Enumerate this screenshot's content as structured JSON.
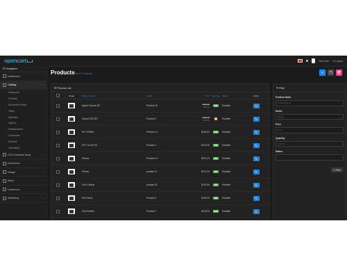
{
  "header": {
    "logo_text": "opencart",
    "user_name": "John Doe",
    "logout_label": "Logout"
  },
  "sidebar": {
    "title": "Navigation",
    "items": [
      {
        "label": "Dashboard"
      },
      {
        "label": "Catalog"
      },
      {
        "label": "OC4 Canadian Shop"
      },
      {
        "label": "Extensions"
      },
      {
        "label": "Design"
      },
      {
        "label": "Sales"
      },
      {
        "label": "Customers"
      },
      {
        "label": "Marketing"
      }
    ],
    "catalog_sub": [
      {
        "label": "Categories"
      },
      {
        "label": "Products"
      },
      {
        "label": "Recurring Profiles"
      },
      {
        "label": "Filters"
      },
      {
        "label": "Attributes"
      },
      {
        "label": "Options"
      },
      {
        "label": "Manufacturers"
      },
      {
        "label": "Downloads"
      },
      {
        "label": "Reviews"
      },
      {
        "label": "Information"
      }
    ]
  },
  "page": {
    "title": "Products",
    "breadcrumb_home": "Home",
    "breadcrumb_current": "Products"
  },
  "list": {
    "heading": "Product List",
    "columns": [
      "Image",
      "Product Name",
      "Model",
      "Price",
      "Quantity",
      "Status",
      "Action"
    ],
    "rows": [
      {
        "name": "Apple Cinema 30\"",
        "model": "Product 15",
        "price_old": "$100.00",
        "price": "$90.00",
        "qty": "990",
        "status": "Enabled"
      },
      {
        "name": "Canon EOS 5D",
        "model": "Product 3",
        "price_old": "$100.00",
        "price": "$80.00",
        "qty": "7",
        "status": "Enabled"
      },
      {
        "name": "HP LP3065",
        "model": "Product 21",
        "price_old": "",
        "price": "$100.00",
        "qty": "1000",
        "status": "Enabled"
      },
      {
        "name": "HTC Touch HD",
        "model": "Product 1",
        "price_old": "",
        "price": "$100.00",
        "qty": "939",
        "status": "Enabled"
      },
      {
        "name": "iPhone",
        "model": "Product 14",
        "price_old": "",
        "price": "$101.00",
        "qty": "970",
        "status": "Enabled"
      },
      {
        "name": "iPhone",
        "model": "product 11",
        "price_old": "",
        "price": "$101.00",
        "qty": "995",
        "status": "Enabled"
      },
      {
        "name": "iPod Classic",
        "model": "product 20",
        "price_old": "",
        "price": "$100.00",
        "qty": "995",
        "status": "Enabled"
      },
      {
        "name": "iPod Nano",
        "model": "Product 9",
        "price_old": "",
        "price": "$100.00",
        "qty": "994",
        "status": "Enabled"
      },
      {
        "name": "iPod Shuffle",
        "model": "Product 7",
        "price_old": "",
        "price": "$100.00",
        "qty": "1000",
        "status": "Enabled"
      },
      {
        "name": "iPod Touch",
        "model": "Product 5",
        "price_old": "",
        "price": "$100.00",
        "qty": "999",
        "status": "Enabled"
      }
    ]
  },
  "filter": {
    "heading": "Filter",
    "fields": [
      {
        "label": "Product Name",
        "placeholder": "Product Name"
      },
      {
        "label": "Model",
        "placeholder": "Model"
      },
      {
        "label": "Price",
        "placeholder": "Price"
      },
      {
        "label": "Quantity",
        "placeholder": "Quantity"
      },
      {
        "label": "Status",
        "placeholder": ""
      }
    ],
    "button_label": "Filter"
  },
  "colors": {
    "accent": "#1e88e5",
    "link": "#3d8bcf",
    "danger": "#e83e8c",
    "enabled": "#5cb85c"
  }
}
